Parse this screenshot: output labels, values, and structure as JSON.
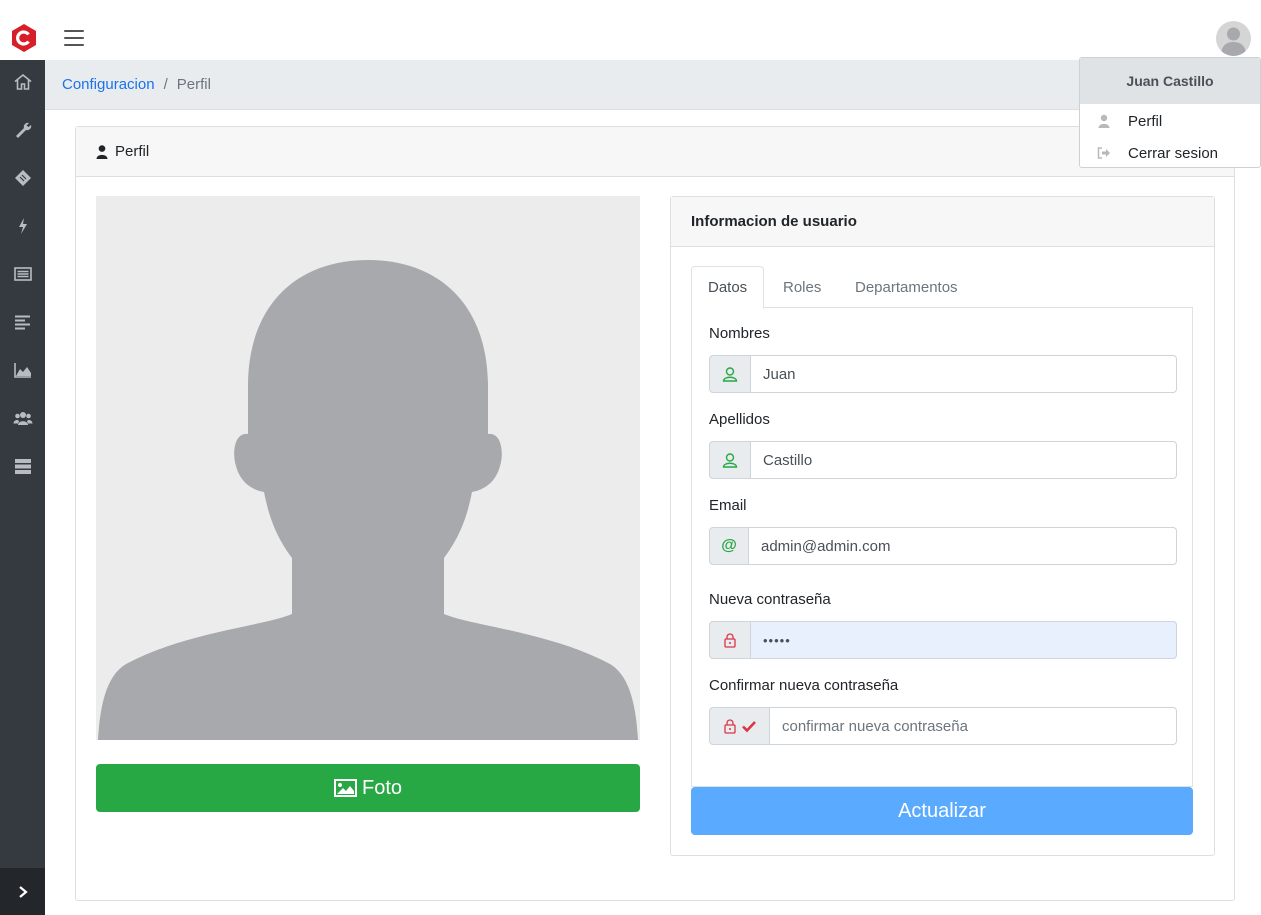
{
  "header": {
    "user_name": "Juan Castillo"
  },
  "breadcrumb": {
    "parent": "Configuracion",
    "separator": "/",
    "current": "Perfil"
  },
  "card": {
    "title": "Perfil"
  },
  "photo": {
    "button_label": "Foto"
  },
  "user_info": {
    "title": "Informacion de usuario",
    "tabs": [
      {
        "label": "Datos",
        "active": true
      },
      {
        "label": "Roles",
        "active": false
      },
      {
        "label": "Departamentos",
        "active": false
      }
    ],
    "fields": {
      "nombres": {
        "label": "Nombres",
        "value": "Juan"
      },
      "apellidos": {
        "label": "Apellidos",
        "value": "Castillo"
      },
      "email": {
        "label": "Email",
        "value": "admin@admin.com"
      },
      "new_password": {
        "label": "Nueva contraseña",
        "value": "•••••"
      },
      "confirm_password": {
        "label": "Confirmar nueva contraseña",
        "value": "",
        "placeholder": "confirmar nueva contraseña"
      }
    },
    "submit_label": "Actualizar"
  },
  "user_menu": {
    "title": "Juan Castillo",
    "items": [
      {
        "label": "Perfil",
        "icon": "user-icon"
      },
      {
        "label": "Cerrar sesion",
        "icon": "sign-out-icon"
      }
    ]
  },
  "sidebar": {
    "items": [
      "home-icon",
      "wrench-icon",
      "ticket-icon",
      "bolt-icon",
      "list-alt-icon",
      "align-left-icon",
      "area-chart-icon",
      "users-icon",
      "server-icon"
    ]
  },
  "colors": {
    "brand_red": "#d71f2a",
    "sidebar_bg": "#343a40",
    "link_blue": "#1a73e8",
    "success_green": "#28a745",
    "primary_button": "#5aaaff",
    "icon_green": "#28a745",
    "icon_red": "#dc3545"
  }
}
